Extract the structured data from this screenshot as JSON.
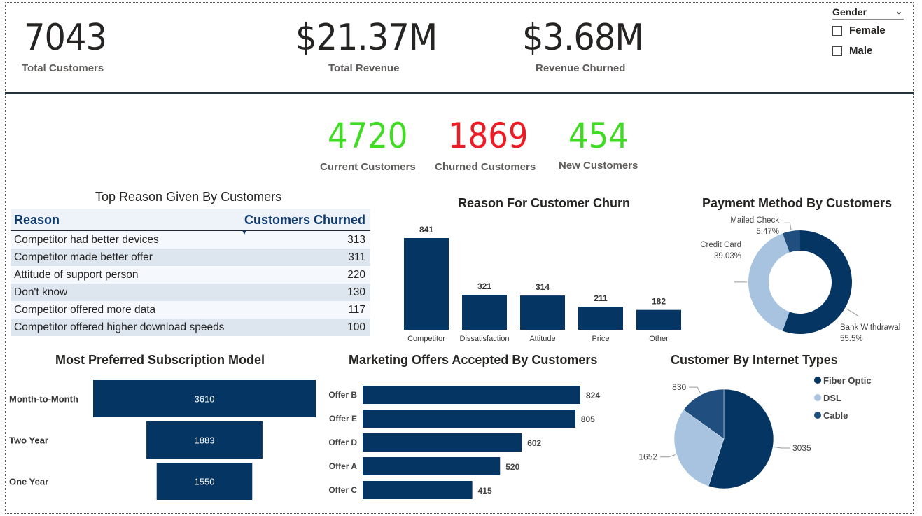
{
  "kpis": {
    "total_customers": {
      "value": "7043",
      "label": "Total Customers"
    },
    "total_revenue": {
      "value": "$21.37M",
      "label": "Total Revenue"
    },
    "revenue_churned": {
      "value": "$3.68M",
      "label": "Revenue Churned"
    }
  },
  "slicer": {
    "title": "Gender",
    "options": [
      "Female",
      "Male"
    ]
  },
  "customer_counts": {
    "current": {
      "value": "4720",
      "label": "Current Customers",
      "color": "#3fdc23"
    },
    "churned": {
      "value": "1869",
      "label": "Churned Customers",
      "color": "#ee1b24"
    },
    "new": {
      "value": "454",
      "label": "New Customers",
      "color": "#3fdc23"
    }
  },
  "colors": {
    "dark_navy": "#053563",
    "light_blue": "#a8c3df",
    "mid_blue": "#1f4e7f"
  },
  "chart_data": [
    {
      "type": "table",
      "title": "Top Reason Given By Customers",
      "columns": [
        "Reason",
        "Customers Churned"
      ],
      "rows": [
        [
          "Competitor had better devices",
          "313"
        ],
        [
          "Competitor made better offer",
          "311"
        ],
        [
          "Attitude of support person",
          "220"
        ],
        [
          "Don't know",
          "130"
        ],
        [
          "Competitor offered more data",
          "117"
        ],
        [
          "Competitor offered higher download speeds",
          "100"
        ]
      ]
    },
    {
      "type": "bar",
      "title": "Reason For Customer Churn",
      "categories": [
        "Competitor",
        "Dissatisfaction",
        "Attitude",
        "Price",
        "Other"
      ],
      "values": [
        841,
        321,
        314,
        211,
        182
      ],
      "ylim": [
        0,
        841
      ]
    },
    {
      "type": "pie",
      "title": "Payment Method By Customers",
      "donut": true,
      "labels": [
        "Bank Withdrawal",
        "Credit Card",
        "Mailed Check"
      ],
      "values": [
        55.5,
        39.03,
        5.47
      ],
      "value_labels": [
        "55.5%",
        "39.03%",
        "5.47%"
      ],
      "colors": [
        "#053563",
        "#a8c3df",
        "#1f4e7f"
      ]
    },
    {
      "type": "bar",
      "orientation": "funnel",
      "title": "Most Preferred Subscription Model",
      "categories": [
        "Month-to-Month",
        "Two Year",
        "One Year"
      ],
      "values": [
        3610,
        1883,
        1550
      ]
    },
    {
      "type": "bar",
      "orientation": "horizontal",
      "title": "Marketing Offers Accepted By Customers",
      "categories": [
        "Offer B",
        "Offer E",
        "Offer D",
        "Offer A",
        "Offer C"
      ],
      "values": [
        824,
        805,
        602,
        520,
        415
      ]
    },
    {
      "type": "pie",
      "title": "Customer By Internet Types",
      "labels": [
        "Fiber Optic",
        "DSL",
        "Cable"
      ],
      "values": [
        3035,
        1652,
        830
      ],
      "colors": [
        "#053563",
        "#a8c3df",
        "#1f4e7f"
      ]
    }
  ]
}
